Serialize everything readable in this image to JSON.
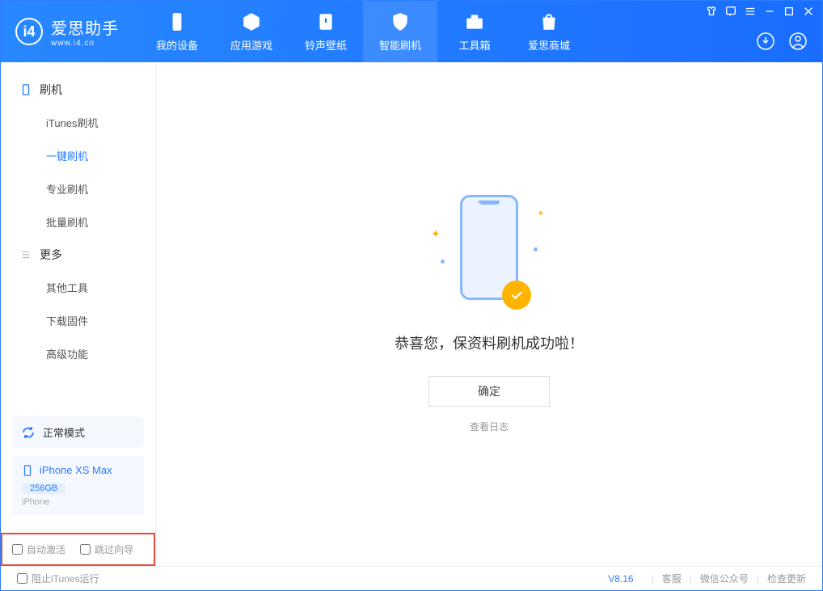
{
  "app": {
    "name": "爱思助手",
    "domain": "www.i4.cn"
  },
  "nav": {
    "tabs": [
      {
        "label": "我的设备"
      },
      {
        "label": "应用游戏"
      },
      {
        "label": "铃声壁纸"
      },
      {
        "label": "智能刷机"
      },
      {
        "label": "工具箱"
      },
      {
        "label": "爱思商城"
      }
    ]
  },
  "sidebar": {
    "section1_title": "刷机",
    "section1_items": [
      "iTunes刷机",
      "一键刷机",
      "专业刷机",
      "批量刷机"
    ],
    "section2_title": "更多",
    "section2_items": [
      "其他工具",
      "下载固件",
      "高级功能"
    ],
    "mode_label": "正常模式",
    "device": {
      "name": "iPhone XS Max",
      "storage": "256GB",
      "type": "iPhone"
    },
    "cb_auto_activate": "自动激活",
    "cb_skip_guide": "跳过向导"
  },
  "main": {
    "success_text": "恭喜您，保资料刷机成功啦！",
    "ok_button": "确定",
    "log_link": "查看日志"
  },
  "footer": {
    "block_itunes": "阻止iTunes运行",
    "version": "V8.16",
    "links": [
      "客服",
      "微信公众号",
      "检查更新"
    ]
  }
}
